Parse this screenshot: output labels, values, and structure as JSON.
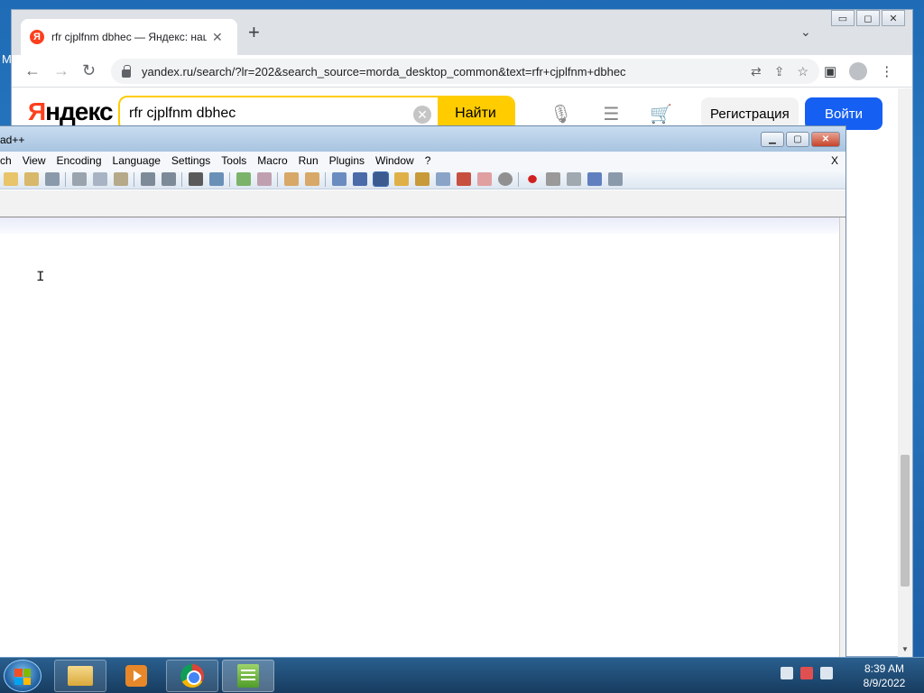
{
  "desktop": {
    "edge_letter": "M"
  },
  "chrome": {
    "tab": {
      "favicon": "Я",
      "title": "rfr cjplfnm dbhec — Яндекс: нашлось",
      "close": "✕"
    },
    "new_tab": "+",
    "tab_search": "⌄",
    "window_buttons": {
      "minimize": "▭",
      "maximize": "◻",
      "close": "✕"
    },
    "nav": {
      "back": "←",
      "forward": "→",
      "reload": "↻"
    },
    "url": "yandex.ru/search/?lr=202&search_source=morda_desktop_common&text=rfr+cjplfnm+dbhec",
    "omni_icons": {
      "translate": "⇄",
      "share": "⇪",
      "bookmark": "☆"
    },
    "toolbar_right": {
      "sidepanel": "▣",
      "menu": "⋮"
    }
  },
  "yandex": {
    "logo_first": "Я",
    "logo_rest": "ндекс",
    "query": "rfr cjplfnm dbhec",
    "clear": "✕",
    "search_button": "Найти",
    "icons": {
      "mic": "🎙",
      "filters": "☰",
      "cart": "🛒"
    },
    "register": "Регистрация",
    "login": "Войти"
  },
  "notepad": {
    "title": "ad++",
    "window_buttons": {
      "minimize": "▁",
      "maximize": "▢",
      "close": "✕"
    },
    "menu": [
      "ch",
      "View",
      "Encoding",
      "Language",
      "Settings",
      "Tools",
      "Macro",
      "Run",
      "Plugins",
      "Window",
      "?"
    ],
    "close_doc": "X",
    "cursor": "I"
  },
  "taskbar": {
    "clock_time": "8:39 AM",
    "clock_date": "8/9/2022"
  }
}
